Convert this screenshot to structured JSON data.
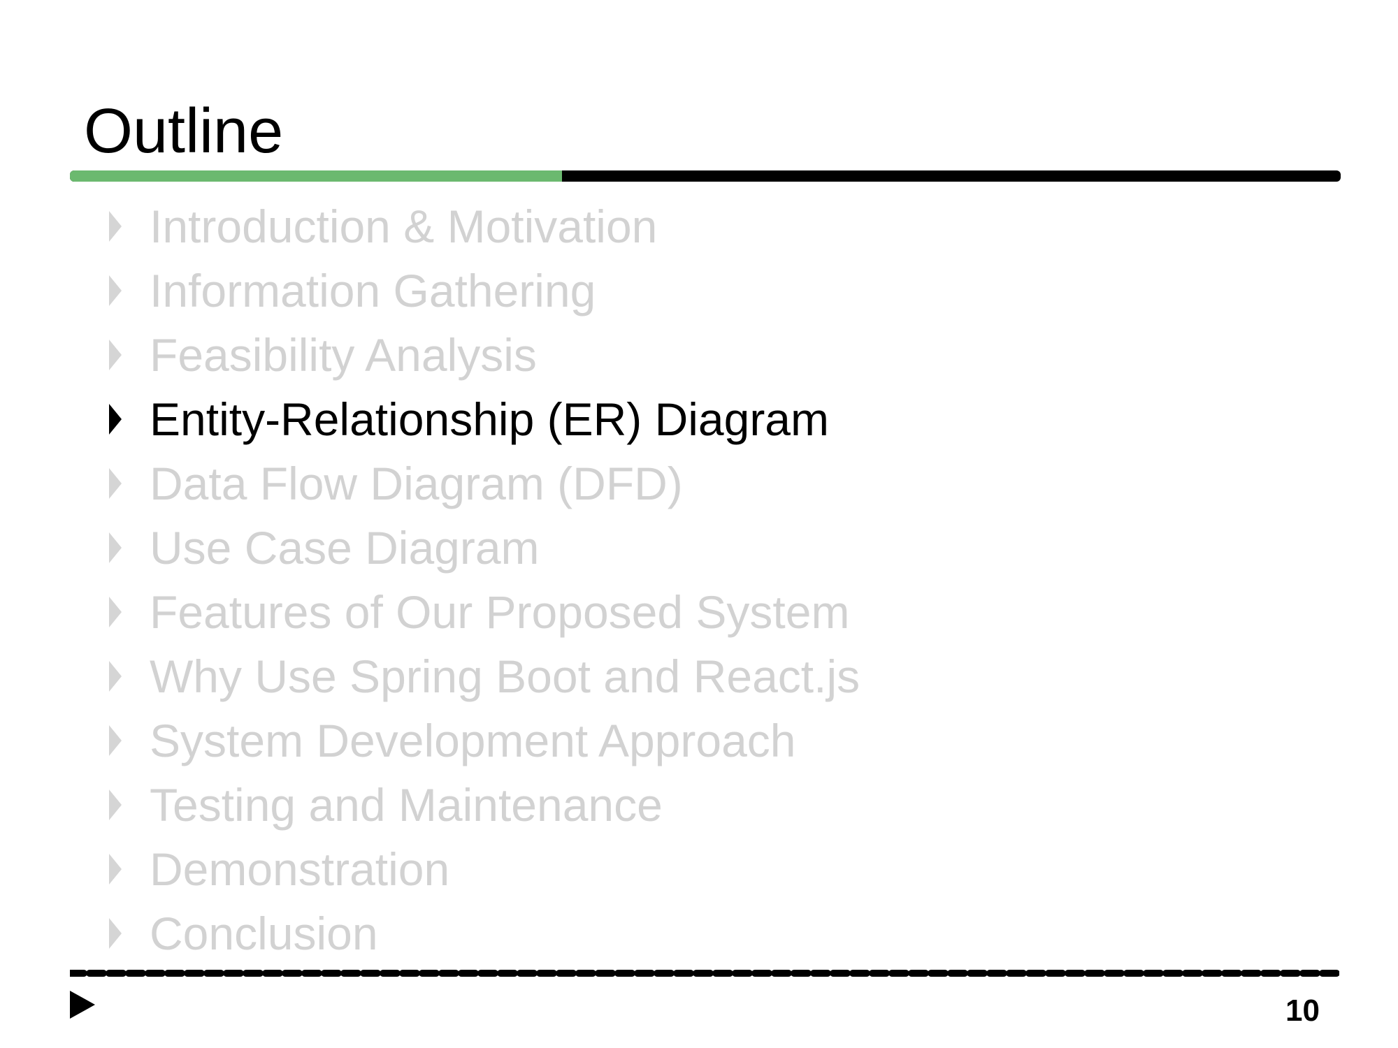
{
  "title": "Outline",
  "colors": {
    "progress_fill": "#6bb96f",
    "progress_track": "#000000",
    "active_text": "#000000",
    "inactive_text": "#d2d2d2",
    "footer_rule": "#000000"
  },
  "progress": 0.387,
  "items": [
    {
      "label": "Introduction & Motivation",
      "active": false
    },
    {
      "label": "Information Gathering",
      "active": false
    },
    {
      "label": "Feasibility Analysis",
      "active": false
    },
    {
      "label": "Entity-Relationship (ER) Diagram",
      "active": true
    },
    {
      "label": "Data Flow Diagram (DFD)",
      "active": false
    },
    {
      "label": "Use Case Diagram",
      "active": false
    },
    {
      "label": "Features of Our Proposed System",
      "active": false
    },
    {
      "label": "Why Use Spring Boot and React.js",
      "active": false
    },
    {
      "label": "System Development Approach",
      "active": false
    },
    {
      "label": "Testing and Maintenance",
      "active": false
    },
    {
      "label": "Demonstration",
      "active": false
    },
    {
      "label": "Conclusion",
      "active": false
    }
  ],
  "footer": {
    "page_number": "10",
    "marker_icon": "play-triangle-icon"
  }
}
